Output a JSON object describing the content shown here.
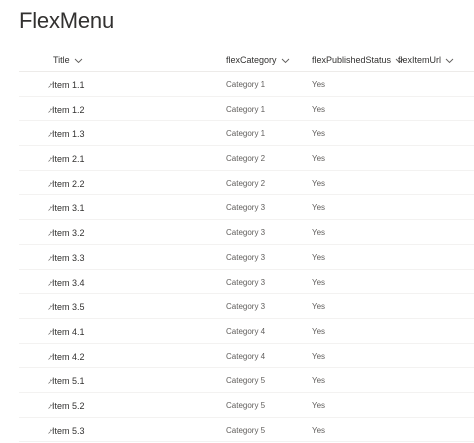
{
  "list": {
    "title": "FlexMenu"
  },
  "columns": [
    {
      "label": "Title"
    },
    {
      "label": "flexCategory"
    },
    {
      "label": "flexPublishedStatus"
    },
    {
      "label": "flexItemUrl"
    }
  ],
  "rows": [
    {
      "title": "Item 1.1",
      "category": "Category 1",
      "status": "Yes",
      "url": ""
    },
    {
      "title": "Item 1.2",
      "category": "Category 1",
      "status": "Yes",
      "url": ""
    },
    {
      "title": "Item 1.3",
      "category": "Category 1",
      "status": "Yes",
      "url": ""
    },
    {
      "title": "Item 2.1",
      "category": "Category 2",
      "status": "Yes",
      "url": ""
    },
    {
      "title": "Item 2.2",
      "category": "Category 2",
      "status": "Yes",
      "url": ""
    },
    {
      "title": "Item 3.1",
      "category": "Category 3",
      "status": "Yes",
      "url": ""
    },
    {
      "title": "Item 3.2",
      "category": "Category 3",
      "status": "Yes",
      "url": ""
    },
    {
      "title": "Item 3.3",
      "category": "Category 3",
      "status": "Yes",
      "url": ""
    },
    {
      "title": "Item 3.4",
      "category": "Category 3",
      "status": "Yes",
      "url": ""
    },
    {
      "title": "Item 3.5",
      "category": "Category 3",
      "status": "Yes",
      "url": ""
    },
    {
      "title": "Item 4.1",
      "category": "Category 4",
      "status": "Yes",
      "url": ""
    },
    {
      "title": "Item 4.2",
      "category": "Category 4",
      "status": "Yes",
      "url": ""
    },
    {
      "title": "Item 5.1",
      "category": "Category 5",
      "status": "Yes",
      "url": ""
    },
    {
      "title": "Item 5.2",
      "category": "Category 5",
      "status": "Yes",
      "url": ""
    },
    {
      "title": "Item 5.3",
      "category": "Category 5",
      "status": "Yes",
      "url": ""
    }
  ],
  "icons": {
    "new_item": "new-item-sparkle-icon",
    "sort": "chevron-down-icon"
  },
  "colors": {
    "text": "#323130",
    "secondary_text": "#605e5c",
    "divider": "#edebe9"
  }
}
